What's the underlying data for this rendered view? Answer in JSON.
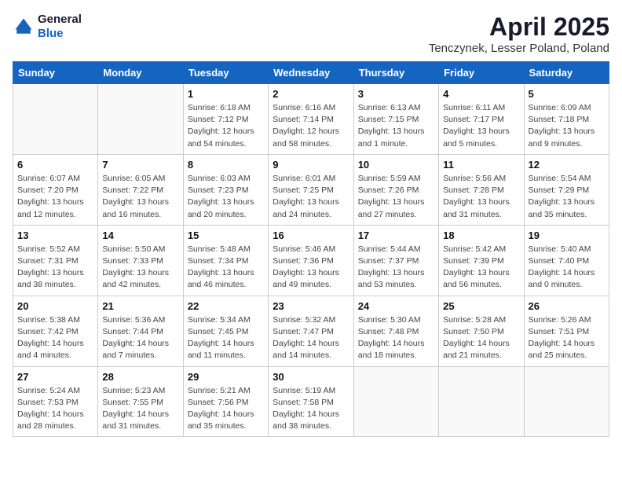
{
  "header": {
    "logo_line1": "General",
    "logo_line2": "Blue",
    "month": "April 2025",
    "location": "Tenczynek, Lesser Poland, Poland"
  },
  "weekdays": [
    "Sunday",
    "Monday",
    "Tuesday",
    "Wednesday",
    "Thursday",
    "Friday",
    "Saturday"
  ],
  "weeks": [
    [
      {
        "day": "",
        "info": ""
      },
      {
        "day": "",
        "info": ""
      },
      {
        "day": "1",
        "info": "Sunrise: 6:18 AM\nSunset: 7:12 PM\nDaylight: 12 hours\nand 54 minutes."
      },
      {
        "day": "2",
        "info": "Sunrise: 6:16 AM\nSunset: 7:14 PM\nDaylight: 12 hours\nand 58 minutes."
      },
      {
        "day": "3",
        "info": "Sunrise: 6:13 AM\nSunset: 7:15 PM\nDaylight: 13 hours\nand 1 minute."
      },
      {
        "day": "4",
        "info": "Sunrise: 6:11 AM\nSunset: 7:17 PM\nDaylight: 13 hours\nand 5 minutes."
      },
      {
        "day": "5",
        "info": "Sunrise: 6:09 AM\nSunset: 7:18 PM\nDaylight: 13 hours\nand 9 minutes."
      }
    ],
    [
      {
        "day": "6",
        "info": "Sunrise: 6:07 AM\nSunset: 7:20 PM\nDaylight: 13 hours\nand 12 minutes."
      },
      {
        "day": "7",
        "info": "Sunrise: 6:05 AM\nSunset: 7:22 PM\nDaylight: 13 hours\nand 16 minutes."
      },
      {
        "day": "8",
        "info": "Sunrise: 6:03 AM\nSunset: 7:23 PM\nDaylight: 13 hours\nand 20 minutes."
      },
      {
        "day": "9",
        "info": "Sunrise: 6:01 AM\nSunset: 7:25 PM\nDaylight: 13 hours\nand 24 minutes."
      },
      {
        "day": "10",
        "info": "Sunrise: 5:59 AM\nSunset: 7:26 PM\nDaylight: 13 hours\nand 27 minutes."
      },
      {
        "day": "11",
        "info": "Sunrise: 5:56 AM\nSunset: 7:28 PM\nDaylight: 13 hours\nand 31 minutes."
      },
      {
        "day": "12",
        "info": "Sunrise: 5:54 AM\nSunset: 7:29 PM\nDaylight: 13 hours\nand 35 minutes."
      }
    ],
    [
      {
        "day": "13",
        "info": "Sunrise: 5:52 AM\nSunset: 7:31 PM\nDaylight: 13 hours\nand 38 minutes."
      },
      {
        "day": "14",
        "info": "Sunrise: 5:50 AM\nSunset: 7:33 PM\nDaylight: 13 hours\nand 42 minutes."
      },
      {
        "day": "15",
        "info": "Sunrise: 5:48 AM\nSunset: 7:34 PM\nDaylight: 13 hours\nand 46 minutes."
      },
      {
        "day": "16",
        "info": "Sunrise: 5:46 AM\nSunset: 7:36 PM\nDaylight: 13 hours\nand 49 minutes."
      },
      {
        "day": "17",
        "info": "Sunrise: 5:44 AM\nSunset: 7:37 PM\nDaylight: 13 hours\nand 53 minutes."
      },
      {
        "day": "18",
        "info": "Sunrise: 5:42 AM\nSunset: 7:39 PM\nDaylight: 13 hours\nand 56 minutes."
      },
      {
        "day": "19",
        "info": "Sunrise: 5:40 AM\nSunset: 7:40 PM\nDaylight: 14 hours\nand 0 minutes."
      }
    ],
    [
      {
        "day": "20",
        "info": "Sunrise: 5:38 AM\nSunset: 7:42 PM\nDaylight: 14 hours\nand 4 minutes."
      },
      {
        "day": "21",
        "info": "Sunrise: 5:36 AM\nSunset: 7:44 PM\nDaylight: 14 hours\nand 7 minutes."
      },
      {
        "day": "22",
        "info": "Sunrise: 5:34 AM\nSunset: 7:45 PM\nDaylight: 14 hours\nand 11 minutes."
      },
      {
        "day": "23",
        "info": "Sunrise: 5:32 AM\nSunset: 7:47 PM\nDaylight: 14 hours\nand 14 minutes."
      },
      {
        "day": "24",
        "info": "Sunrise: 5:30 AM\nSunset: 7:48 PM\nDaylight: 14 hours\nand 18 minutes."
      },
      {
        "day": "25",
        "info": "Sunrise: 5:28 AM\nSunset: 7:50 PM\nDaylight: 14 hours\nand 21 minutes."
      },
      {
        "day": "26",
        "info": "Sunrise: 5:26 AM\nSunset: 7:51 PM\nDaylight: 14 hours\nand 25 minutes."
      }
    ],
    [
      {
        "day": "27",
        "info": "Sunrise: 5:24 AM\nSunset: 7:53 PM\nDaylight: 14 hours\nand 28 minutes."
      },
      {
        "day": "28",
        "info": "Sunrise: 5:23 AM\nSunset: 7:55 PM\nDaylight: 14 hours\nand 31 minutes."
      },
      {
        "day": "29",
        "info": "Sunrise: 5:21 AM\nSunset: 7:56 PM\nDaylight: 14 hours\nand 35 minutes."
      },
      {
        "day": "30",
        "info": "Sunrise: 5:19 AM\nSunset: 7:58 PM\nDaylight: 14 hours\nand 38 minutes."
      },
      {
        "day": "",
        "info": ""
      },
      {
        "day": "",
        "info": ""
      },
      {
        "day": "",
        "info": ""
      }
    ]
  ]
}
